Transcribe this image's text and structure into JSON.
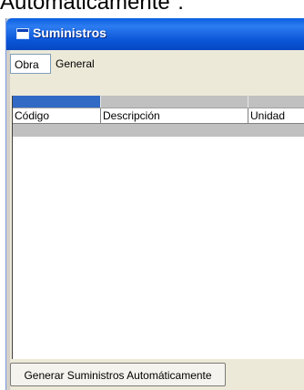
{
  "caption_text": "Automáticamente\".",
  "window": {
    "title": "Suministros",
    "icon": "window-icon"
  },
  "tabs": [
    {
      "label": "Obra",
      "selected": true
    },
    {
      "label": "General",
      "selected": false
    }
  ],
  "table": {
    "columns": [
      "Código",
      "Descripción",
      "Unidad"
    ],
    "rows": []
  },
  "actions": {
    "generate_label": "Generar Suministros Automáticamente"
  }
}
